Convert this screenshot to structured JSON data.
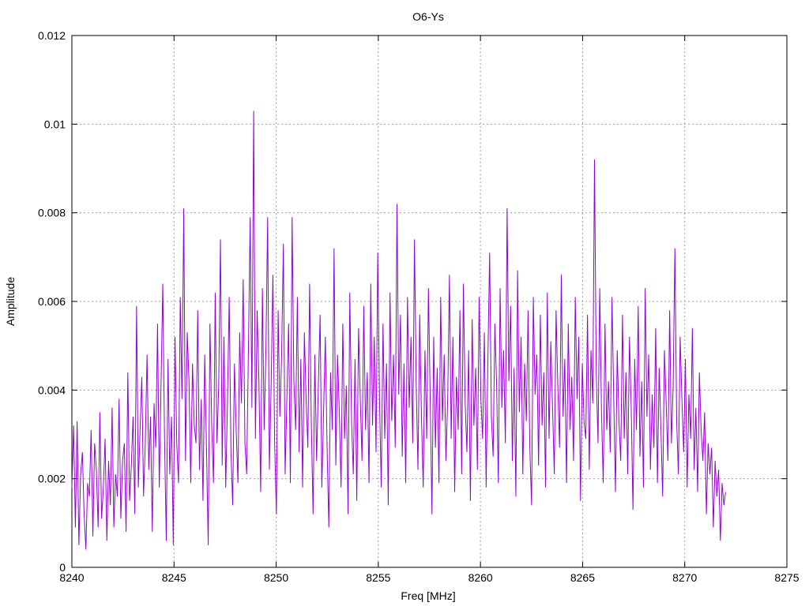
{
  "chart_data": {
    "type": "line",
    "title": "O6-Ys",
    "xlabel": "Freq [MHz]",
    "ylabel": "Amplitude",
    "xlim": [
      8240,
      8275
    ],
    "ylim": [
      0,
      0.012
    ],
    "xticks": [
      "8240",
      "8245",
      "8250",
      "8255",
      "8260",
      "8265",
      "8270",
      "8275"
    ],
    "yticks": [
      "0",
      "0.002",
      "0.004",
      "0.006",
      "0.008",
      "0.01",
      "0.012"
    ],
    "grid": true,
    "series_color": "#9400d3",
    "series": [
      {
        "x_start": 8240,
        "x_end": 8272,
        "values": [
          0.0018,
          0.0032,
          0.0009,
          0.0033,
          0.0005,
          0.0021,
          0.0026,
          0.0012,
          0.0004,
          0.0019,
          0.0016,
          0.0031,
          0.0007,
          0.0028,
          0.0022,
          0.0009,
          0.0035,
          0.0011,
          0.0018,
          0.0029,
          0.0006,
          0.0024,
          0.0014,
          0.0036,
          0.0009,
          0.0021,
          0.0016,
          0.0038,
          0.0011,
          0.0024,
          0.0028,
          0.0008,
          0.0044,
          0.0015,
          0.0023,
          0.0034,
          0.0012,
          0.0059,
          0.0018,
          0.0031,
          0.0043,
          0.0016,
          0.0028,
          0.0048,
          0.0022,
          0.0034,
          0.0008,
          0.0037,
          0.0027,
          0.0055,
          0.0018,
          0.0041,
          0.0064,
          0.0029,
          0.0006,
          0.0047,
          0.0021,
          0.0034,
          0.0005,
          0.0052,
          0.0028,
          0.0019,
          0.0061,
          0.0038,
          0.0081,
          0.0024,
          0.0053,
          0.0042,
          0.0019,
          0.0046,
          0.0032,
          0.0028,
          0.0058,
          0.0022,
          0.0038,
          0.0015,
          0.0048,
          0.0027,
          0.0005,
          0.0055,
          0.0032,
          0.0019,
          0.0062,
          0.0028,
          0.0041,
          0.0074,
          0.0023,
          0.0052,
          0.0018,
          0.0037,
          0.0061,
          0.0026,
          0.0014,
          0.0046,
          0.0031,
          0.0019,
          0.0053,
          0.0037,
          0.0065,
          0.0028,
          0.0021,
          0.0049,
          0.0079,
          0.0036,
          0.0103,
          0.0029,
          0.0058,
          0.0042,
          0.0017,
          0.0063,
          0.0031,
          0.0049,
          0.0079,
          0.0022,
          0.0041,
          0.0066,
          0.0028,
          0.0012,
          0.0058,
          0.0034,
          0.0048,
          0.0073,
          0.0021,
          0.0038,
          0.0055,
          0.0019,
          0.0079,
          0.0042,
          0.0031,
          0.0061,
          0.0026,
          0.0047,
          0.0018,
          0.0053,
          0.0038,
          0.0027,
          0.0064,
          0.0032,
          0.0012,
          0.0048,
          0.0024,
          0.0041,
          0.0057,
          0.0018,
          0.0035,
          0.0052,
          0.0027,
          0.0009,
          0.0044,
          0.0031,
          0.0072,
          0.0023,
          0.0048,
          0.0035,
          0.0018,
          0.0055,
          0.0029,
          0.0041,
          0.0012,
          0.0062,
          0.0033,
          0.0021,
          0.0047,
          0.0015,
          0.0054,
          0.0038,
          0.0024,
          0.0059,
          0.0031,
          0.0044,
          0.0019,
          0.0064,
          0.0032,
          0.0052,
          0.0026,
          0.0071,
          0.0038,
          0.0018,
          0.0055,
          0.0029,
          0.0046,
          0.0014,
          0.0062,
          0.0033,
          0.0048,
          0.0027,
          0.0082,
          0.0039,
          0.0057,
          0.0025,
          0.0046,
          0.0019,
          0.0061,
          0.0036,
          0.0052,
          0.0028,
          0.0074,
          0.0041,
          0.0022,
          0.0057,
          0.0034,
          0.0018,
          0.0049,
          0.0029,
          0.0063,
          0.0038,
          0.0012,
          0.0052,
          0.0027,
          0.0045,
          0.0019,
          0.0061,
          0.0033,
          0.0048,
          0.0024,
          0.0038,
          0.0066,
          0.0029,
          0.0052,
          0.0017,
          0.0043,
          0.0031,
          0.0058,
          0.0021,
          0.0064,
          0.0037,
          0.0026,
          0.0049,
          0.0015,
          0.0056,
          0.0032,
          0.0045,
          0.0022,
          0.0061,
          0.0038,
          0.0029,
          0.0053,
          0.0018,
          0.0047,
          0.0071,
          0.0034,
          0.0025,
          0.0055,
          0.0041,
          0.0019,
          0.0063,
          0.0036,
          0.0049,
          0.0028,
          0.0081,
          0.0042,
          0.0059,
          0.0024,
          0.0045,
          0.0016,
          0.0067,
          0.0035,
          0.0052,
          0.0021,
          0.0046,
          0.0033,
          0.0058,
          0.0027,
          0.0014,
          0.0061,
          0.0039,
          0.0048,
          0.0023,
          0.0057,
          0.0032,
          0.0044,
          0.0018,
          0.0062,
          0.0029,
          0.0051,
          0.0036,
          0.0021,
          0.0058,
          0.0041,
          0.0027,
          0.0066,
          0.0034,
          0.0047,
          0.0019,
          0.0055,
          0.0031,
          0.0043,
          0.0024,
          0.0061,
          0.0038,
          0.0052,
          0.0015,
          0.0046,
          0.0033,
          0.0029,
          0.0057,
          0.0022,
          0.0049,
          0.0037,
          0.0092,
          0.0044,
          0.0028,
          0.0063,
          0.0035,
          0.0019,
          0.0055,
          0.0031,
          0.0042,
          0.0026,
          0.0061,
          0.0038,
          0.0017,
          0.0049,
          0.0033,
          0.0024,
          0.0057,
          0.0029,
          0.0044,
          0.0021,
          0.0052,
          0.0036,
          0.0013,
          0.0047,
          0.0031,
          0.0059,
          0.0025,
          0.0042,
          0.0018,
          0.0063,
          0.0034,
          0.0048,
          0.0022,
          0.0039,
          0.0027,
          0.0054,
          0.0019,
          0.0045,
          0.0031,
          0.0016,
          0.0049,
          0.0037,
          0.0024,
          0.0058,
          0.0028,
          0.0041,
          0.0072,
          0.0033,
          0.0021,
          0.0052,
          0.0038,
          0.0026,
          0.0047,
          0.0018,
          0.0039,
          0.0029,
          0.0054,
          0.0022,
          0.0036,
          0.0017,
          0.0044,
          0.0031,
          0.0024,
          0.0035,
          0.0012,
          0.0028,
          0.0021,
          0.0027,
          0.0009,
          0.0024,
          0.0016,
          0.0022,
          0.0006,
          0.0019,
          0.0014,
          0.0017
        ]
      }
    ]
  }
}
